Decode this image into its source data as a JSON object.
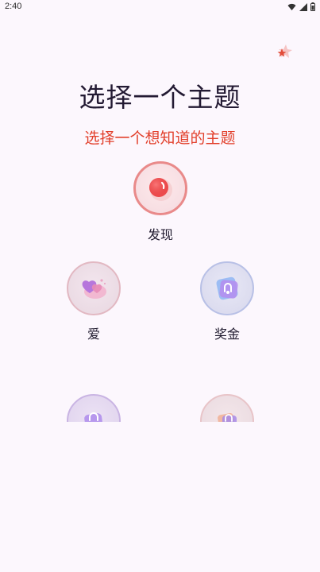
{
  "status_bar": {
    "time": "2:40",
    "icons": [
      "wifi-icon",
      "signal-icon",
      "battery-icon"
    ]
  },
  "header": {
    "title": "选择一个主题",
    "subtitle": "选择一个想知道的主题"
  },
  "topics": [
    {
      "label": "发现",
      "icon": "record-icon"
    },
    {
      "label": "爱",
      "icon": "hearts-icon"
    },
    {
      "label": "奖金",
      "icon": "gift-card-icon"
    },
    {
      "label": "",
      "icon": "bag-icon"
    },
    {
      "label": "",
      "icon": "bag-icon"
    }
  ],
  "colors": {
    "background": "#fcf7fd",
    "title": "#231a33",
    "subtitle": "#e2402c",
    "discover_accent": "#e94b4b"
  }
}
